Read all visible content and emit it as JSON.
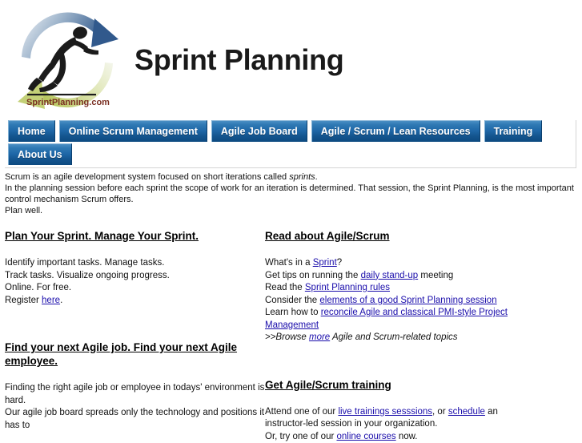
{
  "site": {
    "title": "Sprint Planning",
    "logo_alt": "SprintPlanning.com running athlete logo",
    "logo_wordmark": "SprintPlanning.com"
  },
  "nav": {
    "rows": [
      [
        {
          "label": "Home"
        },
        {
          "label": "Online Scrum Management"
        },
        {
          "label": "Agile Job Board"
        },
        {
          "label": "Agile / Scrum / Lean Resources"
        },
        {
          "label": "Training"
        }
      ],
      [
        {
          "label": "About Us"
        }
      ]
    ]
  },
  "intro": {
    "line1_a": "Scrum is an agile development system focused on short iterations called ",
    "line1_em": "sprints",
    "line1_b": ".",
    "line2": "In the planning session before each sprint the scope of work for an iteration is determined. That session, the Sprint Planning, is the most important control mechanism Scrum offers.",
    "line3": "Plan well."
  },
  "left_column": {
    "block1": {
      "title": "Plan Your Sprint. Manage Your Sprint.",
      "line1": "Identify important tasks. Manage tasks.",
      "line2": "Track tasks. Visualize ongoing progress.",
      "line3": "Online. For free.",
      "line4_pre": "Register ",
      "line4_link": "here",
      "line4_post": "."
    },
    "block2": {
      "title": "Find your next Agile job. Find your next Agile employee.",
      "line1": "Finding the right agile job or employee in todays' environment is hard.",
      "line2": "Our agile job board spreads only the technology and positions it has to"
    }
  },
  "right_column": {
    "block1": {
      "title": "Read about Agile/Scrum",
      "line1_pre": "What's in a ",
      "line1_link": "Sprint",
      "line1_post": "?",
      "line2_pre": "Get tips on running the ",
      "line2_link": "daily stand-up",
      "line2_post": " meeting",
      "line3_pre": "Read the ",
      "line3_link": "Sprint Planning rules",
      "line3_post": "",
      "line4_pre": "Consider the ",
      "line4_link": "elements of a good Sprint Planning session",
      "line4_post": "",
      "line5_pre": "Learn how to ",
      "line5_link": "reconcile Agile and classical PMI-style Project Management",
      "line5_post": "",
      "line6_pre": ">>Browse ",
      "line6_link": "more",
      "line6_post": " Agile and Scrum-related topics"
    },
    "block2": {
      "title": "Get Agile/Scrum training",
      "line1_pre": "Attend one of our ",
      "line1_link_a": "live trainings sesssions",
      "line1_mid": ", or ",
      "line1_link_b": "schedule",
      "line1_post": " an instructor-led session in your organization.",
      "line2_pre": "Or, try one of our ",
      "line2_link": "online courses",
      "line2_post": " now."
    }
  },
  "colors": {
    "nav_blue_top": "#2f79b4",
    "nav_blue_bottom": "#0d4a80",
    "link": "#1a0dab",
    "logo_arrow_blue": "#3a5f8a",
    "logo_arrow_green": "#bcc96b",
    "text": "#111111"
  }
}
